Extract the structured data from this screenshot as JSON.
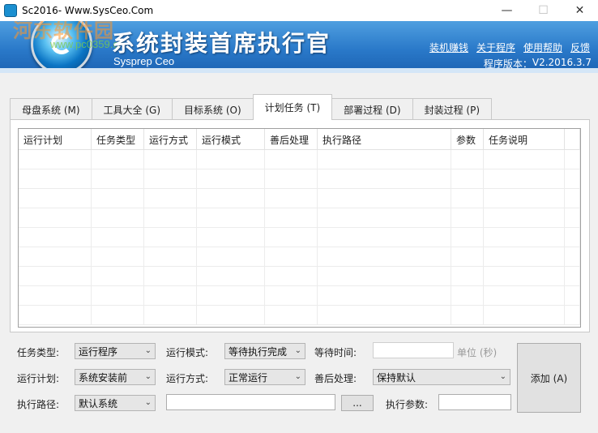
{
  "window": {
    "title": "Sc2016- Www.SysCeo.Com",
    "minimize": "—",
    "maximize": "☐",
    "close": "✕"
  },
  "banner": {
    "title": "系统封装首席执行官",
    "subtitle": "Sysprep Ceo",
    "watermark": "河东软件园",
    "watermark_url": "www.pc0359.cn",
    "links": [
      "装机赚钱",
      "关于程序",
      "使用帮助",
      "反馈"
    ],
    "version_label": "程序版本：",
    "version_value": "V2.2016.3.7"
  },
  "tabs": [
    {
      "label": "母盘系统 (M)",
      "active": false
    },
    {
      "label": "工具大全 (G)",
      "active": false
    },
    {
      "label": "目标系统 (O)",
      "active": false
    },
    {
      "label": "计划任务 (T)",
      "active": true
    },
    {
      "label": "部署过程 (D)",
      "active": false
    },
    {
      "label": "封装过程 (P)",
      "active": false
    }
  ],
  "table": {
    "columns": [
      "运行计划",
      "任务类型",
      "运行方式",
      "运行模式",
      "善后处理",
      "执行路径",
      "参数",
      "任务说明"
    ]
  },
  "form": {
    "task_type_label": "任务类型:",
    "task_type_value": "运行程序",
    "run_mode_label": "运行模式:",
    "run_mode_value": "等待执行完成",
    "wait_time_label": "等待时间:",
    "wait_time_value": "",
    "unit_label": "单位 (秒)",
    "run_plan_label": "运行计划:",
    "run_plan_value": "系统安装前",
    "run_method_label": "运行方式:",
    "run_method_value": "正常运行",
    "aftercare_label": "善后处理:",
    "aftercare_value": "保持默认",
    "exec_path_label": "执行路径:",
    "exec_path_value": "默认系统",
    "path_input_value": "",
    "browse_label": "...",
    "exec_params_label": "执行参数:",
    "exec_params_value": "",
    "add_button": "添加 (A)"
  }
}
